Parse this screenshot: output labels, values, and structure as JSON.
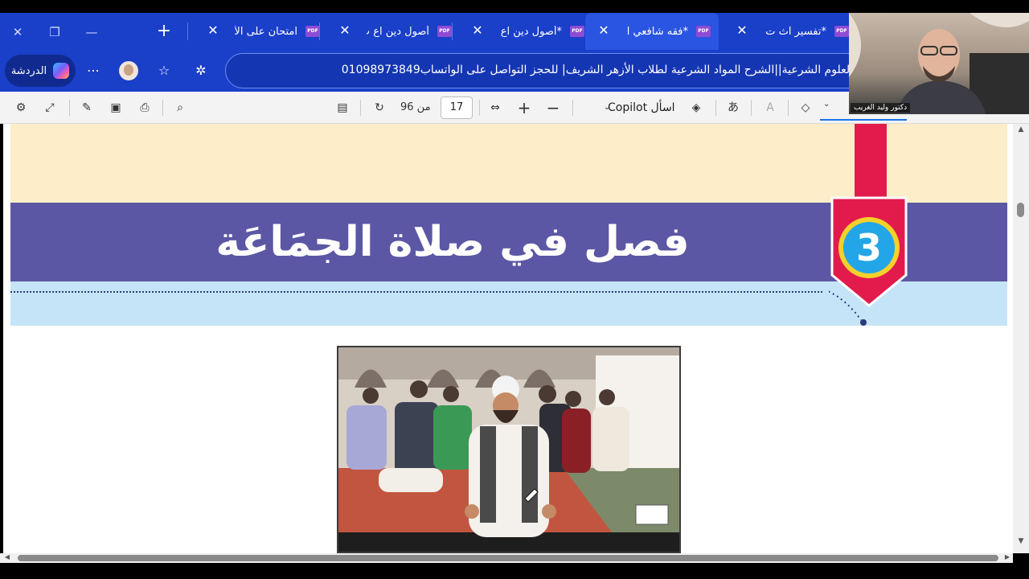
{
  "tabs": [
    {
      "label": "*تفسير آث ت",
      "active": false
    },
    {
      "label": "*فقه شافعي ا",
      "active": true
    },
    {
      "label": "*أصول دين اع",
      "active": false
    },
    {
      "label": "أصول دين اع ب",
      "active": false
    },
    {
      "label": "امتحان على الأ",
      "active": false
    }
  ],
  "addressbar": {
    "url_text": "العلوم الشرعية||الشرح المواد الشرعية لطلاب الأزهر الشريف| للحجز التواصل على الواتساب01098973849",
    "chat_label": "الدردشة"
  },
  "pdf_toolbar": {
    "current_page": "17",
    "of_label": "من 96",
    "ask_copilot_label": "اسأل Copilot"
  },
  "document": {
    "banner_title": "فصل في صلاة الجمَاعَة",
    "section_number": "3"
  },
  "webcam": {
    "name_label": "دكتور وليد الغريب"
  },
  "colors": {
    "tab_bar": "#1a3fc9",
    "banner": "#5b57a5",
    "ribbon": "#e31b4d",
    "badge_ring": "#f4d12b",
    "badge_fill": "#22a6e8",
    "cream": "#fdeec9",
    "light_blue": "#c6e4f7"
  }
}
